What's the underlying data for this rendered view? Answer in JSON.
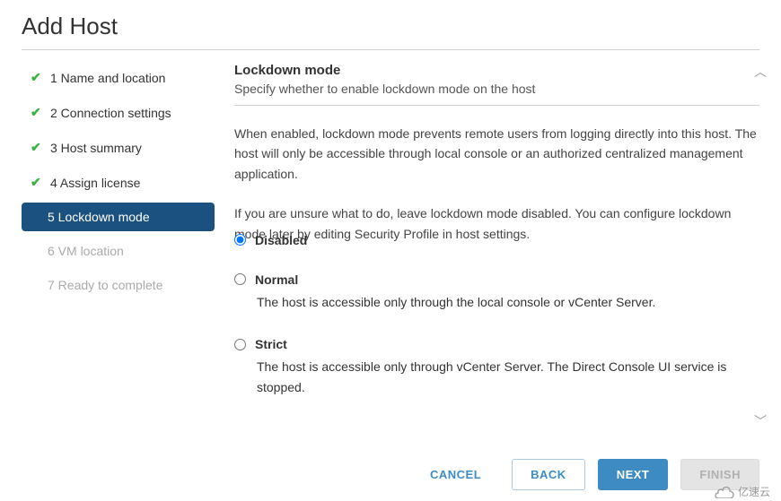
{
  "title": "Add Host",
  "steps": [
    {
      "label": "1 Name and location"
    },
    {
      "label": "2 Connection settings"
    },
    {
      "label": "3 Host summary"
    },
    {
      "label": "4 Assign license"
    },
    {
      "label": "5 Lockdown mode"
    },
    {
      "label": "6 VM location"
    },
    {
      "label": "7 Ready to complete"
    }
  ],
  "section": {
    "title": "Lockdown mode",
    "subtitle": "Specify whether to enable lockdown mode on the host",
    "para1": "When enabled, lockdown mode prevents remote users from logging directly into this host. The host will only be accessible through local console or an authorized centralized management application.",
    "para2": "If you are unsure what to do, leave lockdown mode disabled. You can configure lockdown mode later by editing Security Profile in host settings."
  },
  "options": {
    "disabled": {
      "label": "Disabled",
      "desc": ""
    },
    "normal": {
      "label": "Normal",
      "desc": "The host is accessible only through the local console or vCenter Server."
    },
    "strict": {
      "label": "Strict",
      "desc": "The host is accessible only through vCenter Server. The Direct Console UI service is stopped."
    }
  },
  "buttons": {
    "cancel": "CANCEL",
    "back": "BACK",
    "next": "NEXT",
    "finish": "FINISH"
  },
  "watermark": "亿速云"
}
